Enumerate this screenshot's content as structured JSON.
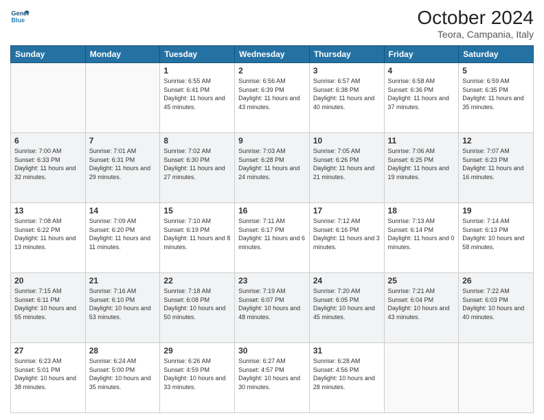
{
  "logo": {
    "line1": "General",
    "line2": "Blue"
  },
  "title": "October 2024",
  "location": "Teora, Campania, Italy",
  "weekdays": [
    "Sunday",
    "Monday",
    "Tuesday",
    "Wednesday",
    "Thursday",
    "Friday",
    "Saturday"
  ],
  "weeks": [
    [
      {
        "day": "",
        "info": ""
      },
      {
        "day": "",
        "info": ""
      },
      {
        "day": "1",
        "info": "Sunrise: 6:55 AM\nSunset: 6:41 PM\nDaylight: 11 hours\nand 45 minutes."
      },
      {
        "day": "2",
        "info": "Sunrise: 6:56 AM\nSunset: 6:39 PM\nDaylight: 11 hours\nand 43 minutes."
      },
      {
        "day": "3",
        "info": "Sunrise: 6:57 AM\nSunset: 6:38 PM\nDaylight: 11 hours\nand 40 minutes."
      },
      {
        "day": "4",
        "info": "Sunrise: 6:58 AM\nSunset: 6:36 PM\nDaylight: 11 hours\nand 37 minutes."
      },
      {
        "day": "5",
        "info": "Sunrise: 6:59 AM\nSunset: 6:35 PM\nDaylight: 11 hours\nand 35 minutes."
      }
    ],
    [
      {
        "day": "6",
        "info": "Sunrise: 7:00 AM\nSunset: 6:33 PM\nDaylight: 11 hours\nand 32 minutes."
      },
      {
        "day": "7",
        "info": "Sunrise: 7:01 AM\nSunset: 6:31 PM\nDaylight: 11 hours\nand 29 minutes."
      },
      {
        "day": "8",
        "info": "Sunrise: 7:02 AM\nSunset: 6:30 PM\nDaylight: 11 hours\nand 27 minutes."
      },
      {
        "day": "9",
        "info": "Sunrise: 7:03 AM\nSunset: 6:28 PM\nDaylight: 11 hours\nand 24 minutes."
      },
      {
        "day": "10",
        "info": "Sunrise: 7:05 AM\nSunset: 6:26 PM\nDaylight: 11 hours\nand 21 minutes."
      },
      {
        "day": "11",
        "info": "Sunrise: 7:06 AM\nSunset: 6:25 PM\nDaylight: 11 hours\nand 19 minutes."
      },
      {
        "day": "12",
        "info": "Sunrise: 7:07 AM\nSunset: 6:23 PM\nDaylight: 11 hours\nand 16 minutes."
      }
    ],
    [
      {
        "day": "13",
        "info": "Sunrise: 7:08 AM\nSunset: 6:22 PM\nDaylight: 11 hours\nand 13 minutes."
      },
      {
        "day": "14",
        "info": "Sunrise: 7:09 AM\nSunset: 6:20 PM\nDaylight: 11 hours\nand 11 minutes."
      },
      {
        "day": "15",
        "info": "Sunrise: 7:10 AM\nSunset: 6:19 PM\nDaylight: 11 hours\nand 8 minutes."
      },
      {
        "day": "16",
        "info": "Sunrise: 7:11 AM\nSunset: 6:17 PM\nDaylight: 11 hours\nand 6 minutes."
      },
      {
        "day": "17",
        "info": "Sunrise: 7:12 AM\nSunset: 6:16 PM\nDaylight: 11 hours\nand 3 minutes."
      },
      {
        "day": "18",
        "info": "Sunrise: 7:13 AM\nSunset: 6:14 PM\nDaylight: 11 hours\nand 0 minutes."
      },
      {
        "day": "19",
        "info": "Sunrise: 7:14 AM\nSunset: 6:13 PM\nDaylight: 10 hours\nand 58 minutes."
      }
    ],
    [
      {
        "day": "20",
        "info": "Sunrise: 7:15 AM\nSunset: 6:11 PM\nDaylight: 10 hours\nand 55 minutes."
      },
      {
        "day": "21",
        "info": "Sunrise: 7:16 AM\nSunset: 6:10 PM\nDaylight: 10 hours\nand 53 minutes."
      },
      {
        "day": "22",
        "info": "Sunrise: 7:18 AM\nSunset: 6:08 PM\nDaylight: 10 hours\nand 50 minutes."
      },
      {
        "day": "23",
        "info": "Sunrise: 7:19 AM\nSunset: 6:07 PM\nDaylight: 10 hours\nand 48 minutes."
      },
      {
        "day": "24",
        "info": "Sunrise: 7:20 AM\nSunset: 6:05 PM\nDaylight: 10 hours\nand 45 minutes."
      },
      {
        "day": "25",
        "info": "Sunrise: 7:21 AM\nSunset: 6:04 PM\nDaylight: 10 hours\nand 43 minutes."
      },
      {
        "day": "26",
        "info": "Sunrise: 7:22 AM\nSunset: 6:03 PM\nDaylight: 10 hours\nand 40 minutes."
      }
    ],
    [
      {
        "day": "27",
        "info": "Sunrise: 6:23 AM\nSunset: 5:01 PM\nDaylight: 10 hours\nand 38 minutes."
      },
      {
        "day": "28",
        "info": "Sunrise: 6:24 AM\nSunset: 5:00 PM\nDaylight: 10 hours\nand 35 minutes."
      },
      {
        "day": "29",
        "info": "Sunrise: 6:26 AM\nSunset: 4:59 PM\nDaylight: 10 hours\nand 33 minutes."
      },
      {
        "day": "30",
        "info": "Sunrise: 6:27 AM\nSunset: 4:57 PM\nDaylight: 10 hours\nand 30 minutes."
      },
      {
        "day": "31",
        "info": "Sunrise: 6:28 AM\nSunset: 4:56 PM\nDaylight: 10 hours\nand 28 minutes."
      },
      {
        "day": "",
        "info": ""
      },
      {
        "day": "",
        "info": ""
      }
    ]
  ]
}
